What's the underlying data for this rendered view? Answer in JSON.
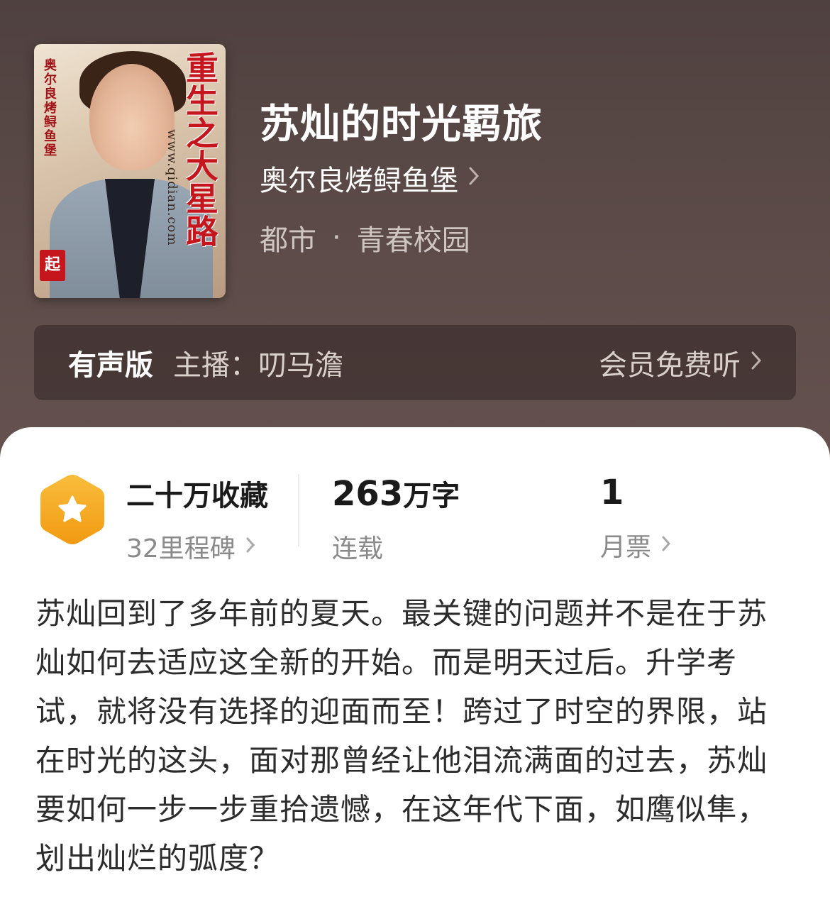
{
  "book": {
    "title": "苏灿的时光羁旅",
    "author": "奥尔良烤鲟鱼堡",
    "category": "都市",
    "subcategory": "青春校园",
    "cover": {
      "title_text": "重生之大星路",
      "author_text": "奥尔良烤鲟鱼堡",
      "url_text": "www.qidian.com",
      "seal_text": "起"
    }
  },
  "audio": {
    "label": "有声版",
    "host": "主播：叨马澹",
    "action": "会员免费听"
  },
  "stats": {
    "favorites": {
      "main": "二十万收藏",
      "sub": "32里程碑"
    },
    "words": {
      "number": "263",
      "unit": "万字",
      "sub": "连载"
    },
    "tickets": {
      "main": "1",
      "sub": "月票"
    }
  },
  "description": "苏灿回到了多年前的夏天。最关键的问题并不是在于苏灿如何去适应这全新的开始。而是明天过后。升学考试，就将没有选择的迎面而至！跨过了时空的界限，站在时光的这头，面对那曾经让他泪流满面的过去，苏灿要如何一步一步重拾遗憾，在这年代下面，如鹰似隼，划出灿烂的弧度？",
  "icons": {
    "chevron": "chevron-right-icon",
    "badge": "star-badge-icon",
    "separator_dot": "·"
  },
  "colors": {
    "header_bg": "#5b4a47",
    "badge_orange": "#f5a623",
    "cover_title_red": "#c4161c"
  }
}
